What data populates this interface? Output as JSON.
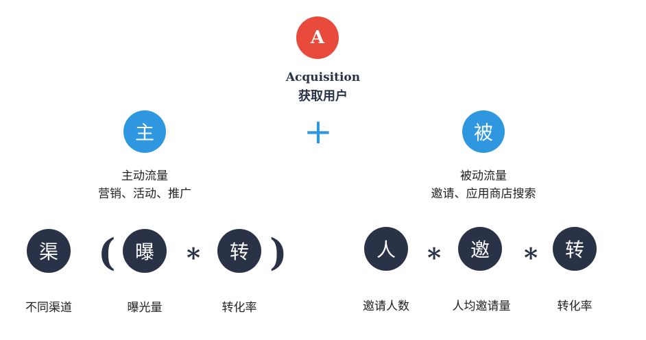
{
  "top": {
    "circle_letter": "A",
    "title_en": "Acquisition",
    "title_cn": "获取用户",
    "accent_color": "#e84a3c"
  },
  "plus_symbol": "+",
  "active": {
    "circle_char": "主",
    "line1": "主动流量",
    "line2": "营销、活动、推广",
    "formula": {
      "open_paren": "(",
      "close_paren": ")",
      "operator": "*",
      "items": [
        {
          "char": "渠",
          "label": "不同渠道"
        },
        {
          "char": "曝",
          "label": "曝光量"
        },
        {
          "char": "转",
          "label": "转化率"
        }
      ]
    }
  },
  "passive": {
    "circle_char": "被",
    "line1": "被动流量",
    "line2": "邀请、应用商店搜索",
    "formula": {
      "operator": "*",
      "items": [
        {
          "char": "人",
          "label": "邀请人数"
        },
        {
          "char": "邀",
          "label": "人均邀请量"
        },
        {
          "char": "转",
          "label": "转化率"
        }
      ]
    }
  },
  "colors": {
    "blue": "#2e97e0",
    "dark": "#2a3247",
    "red": "#e84a3c"
  }
}
